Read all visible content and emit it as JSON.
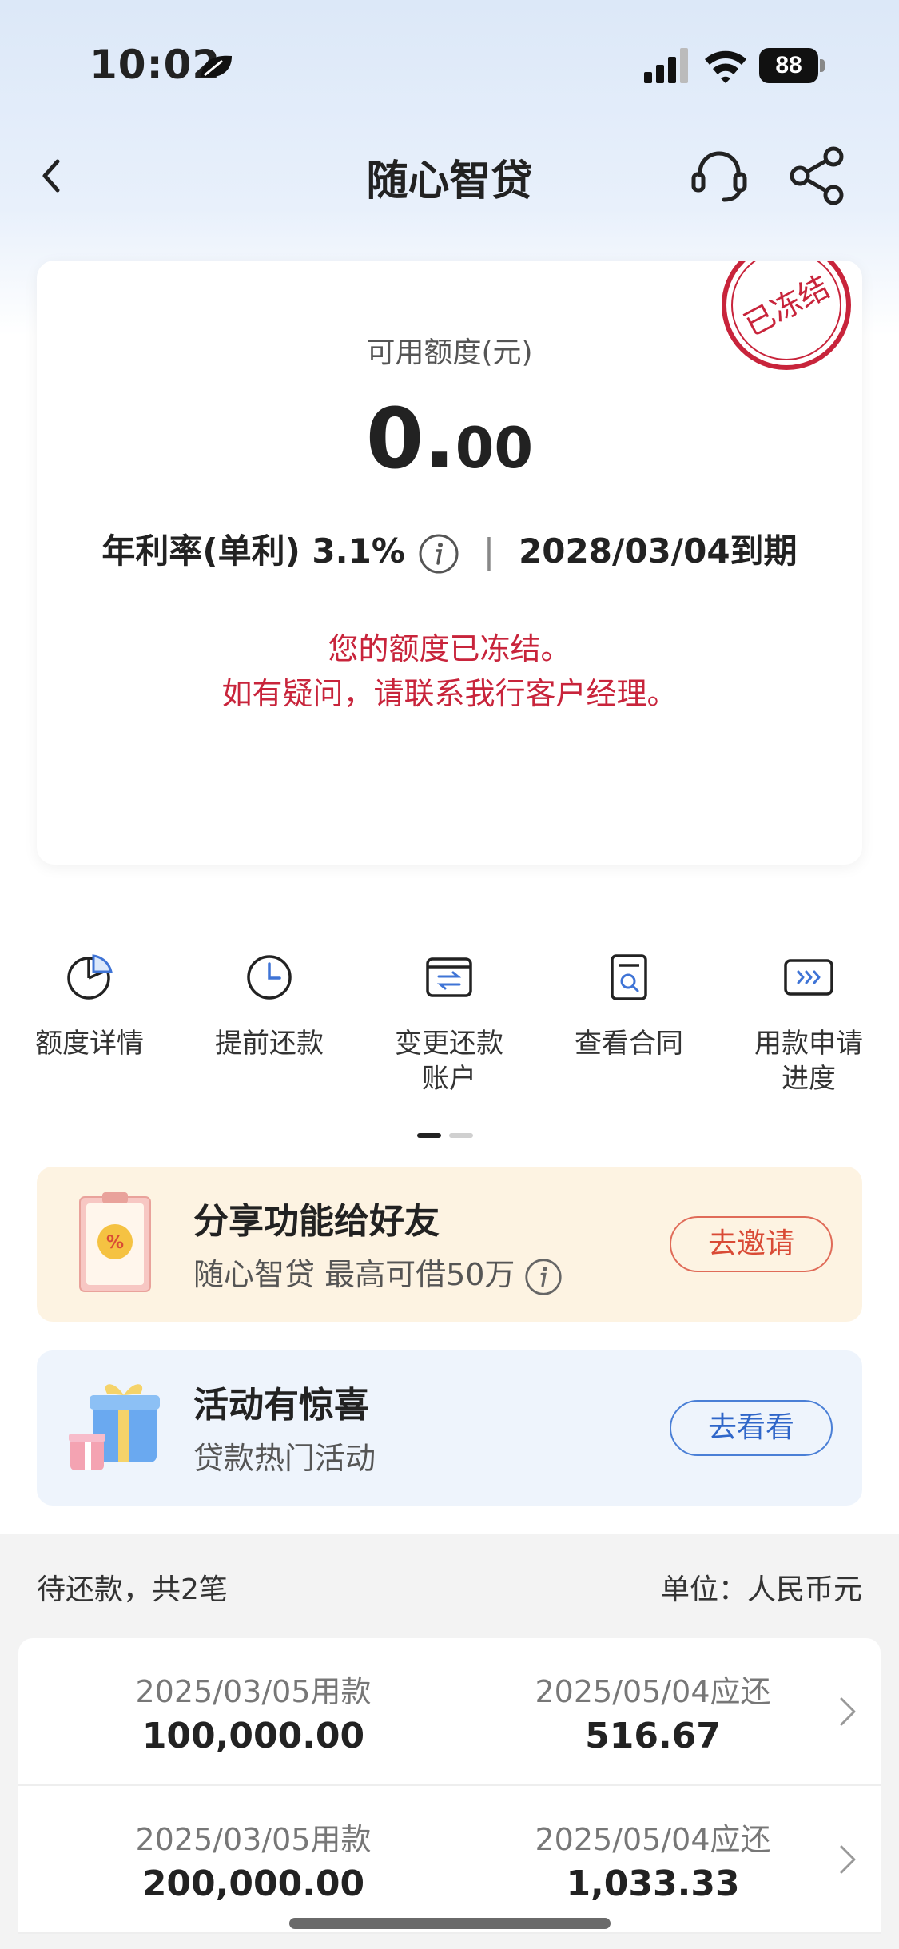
{
  "status_bar": {
    "time": "10:02",
    "battery": "88"
  },
  "nav": {
    "title": "随心智贷"
  },
  "credit": {
    "stamp_text": "已冻结",
    "available_label": "可用额度(元)",
    "amount_int": "0.",
    "amount_dec": "00",
    "rate_text": "年利率(单利) 3.1%",
    "separator": "|",
    "due_text": "2028/03/04到期",
    "freeze_line1": "您的额度已冻结。",
    "freeze_line2": "如有疑问，请联系我行客户经理。"
  },
  "quick_actions": [
    {
      "label": "额度详情",
      "icon": "pie-chart-icon"
    },
    {
      "label": "提前还款",
      "icon": "clock-icon"
    },
    {
      "label_line1": "变更还款",
      "label_line2": "账户",
      "icon": "card-swap-icon"
    },
    {
      "label": "查看合同",
      "icon": "document-search-icon"
    },
    {
      "label_line1": "用款申请",
      "label_line2": "进度",
      "icon": "progress-arrows-icon"
    }
  ],
  "invite": {
    "title": "分享功能给好友",
    "subtitle": "随心智贷 最高可借50万",
    "button": "去邀请"
  },
  "promo": {
    "title": "活动有惊喜",
    "subtitle": "贷款热门活动",
    "button": "去看看"
  },
  "pending": {
    "summary": "待还款，共2笔",
    "unit": "单位：人民币元",
    "loans": [
      {
        "borrow_date": "2025/03/05用款",
        "amount": "100,000.00",
        "due_date": "2025/05/04应还",
        "due_amount": "516.67"
      },
      {
        "borrow_date": "2025/03/05用款",
        "amount": "200,000.00",
        "due_date": "2025/05/04应还",
        "due_amount": "1,033.33"
      }
    ]
  },
  "colors": {
    "accent_red": "#c8243b",
    "accent_blue": "#2f66c9",
    "invite_bg": "#fdf3e2",
    "promo_bg": "#eef4fc"
  }
}
